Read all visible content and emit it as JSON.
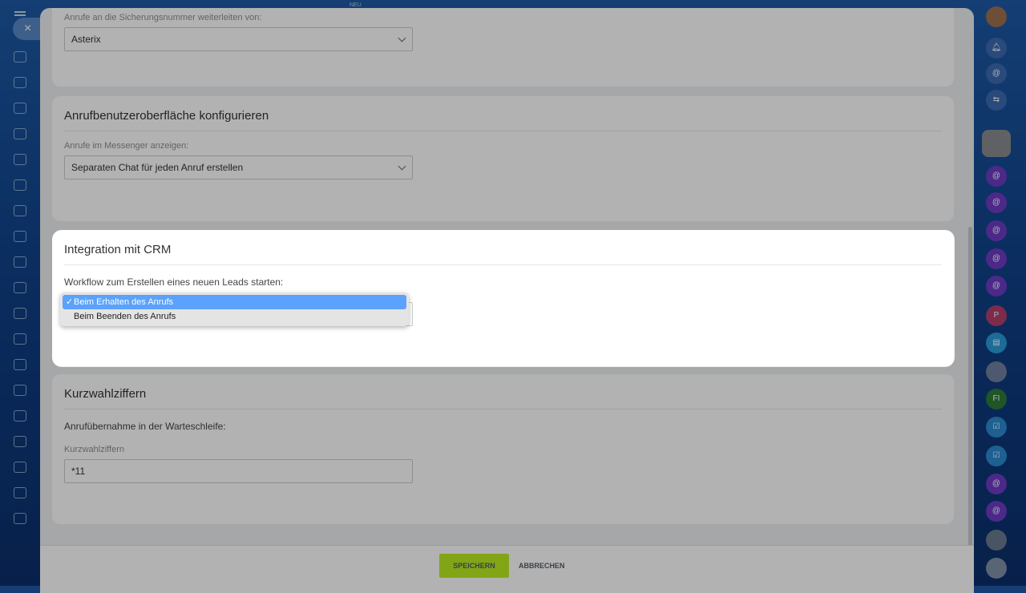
{
  "topbar": {
    "new_badge": "NEU",
    "close": "×"
  },
  "sections": {
    "forwarding": {
      "label": "Anrufe an die Sicherungsnummer weiterleiten von:",
      "value": "Asterix"
    },
    "ui": {
      "title": "Anrufbenutzeroberfläche konfigurieren",
      "label": "Anrufe im Messenger anzeigen:",
      "value": "Separaten Chat für jeden Anruf erstellen"
    },
    "crm": {
      "title": "Integration mit CRM",
      "label": "Workflow zum Erstellen eines neuen Leads starten:",
      "options": [
        {
          "label": "Beim Erhalten des Anrufs",
          "selected": true,
          "check": "✓"
        },
        {
          "label": "Beim Beenden des Anrufs",
          "selected": false
        }
      ]
    },
    "speed": {
      "title": "Kurzwahlziffern",
      "sublabel": "Anrufübernahme in der Warteschleife:",
      "field_label": "Kurzwahlziffern",
      "value": "*11"
    }
  },
  "footer": {
    "save": "SPEICHERN",
    "cancel": "ABBRECHEN"
  },
  "right_sidebar": {
    "initials_p": "P",
    "initials_fi": "FI"
  }
}
